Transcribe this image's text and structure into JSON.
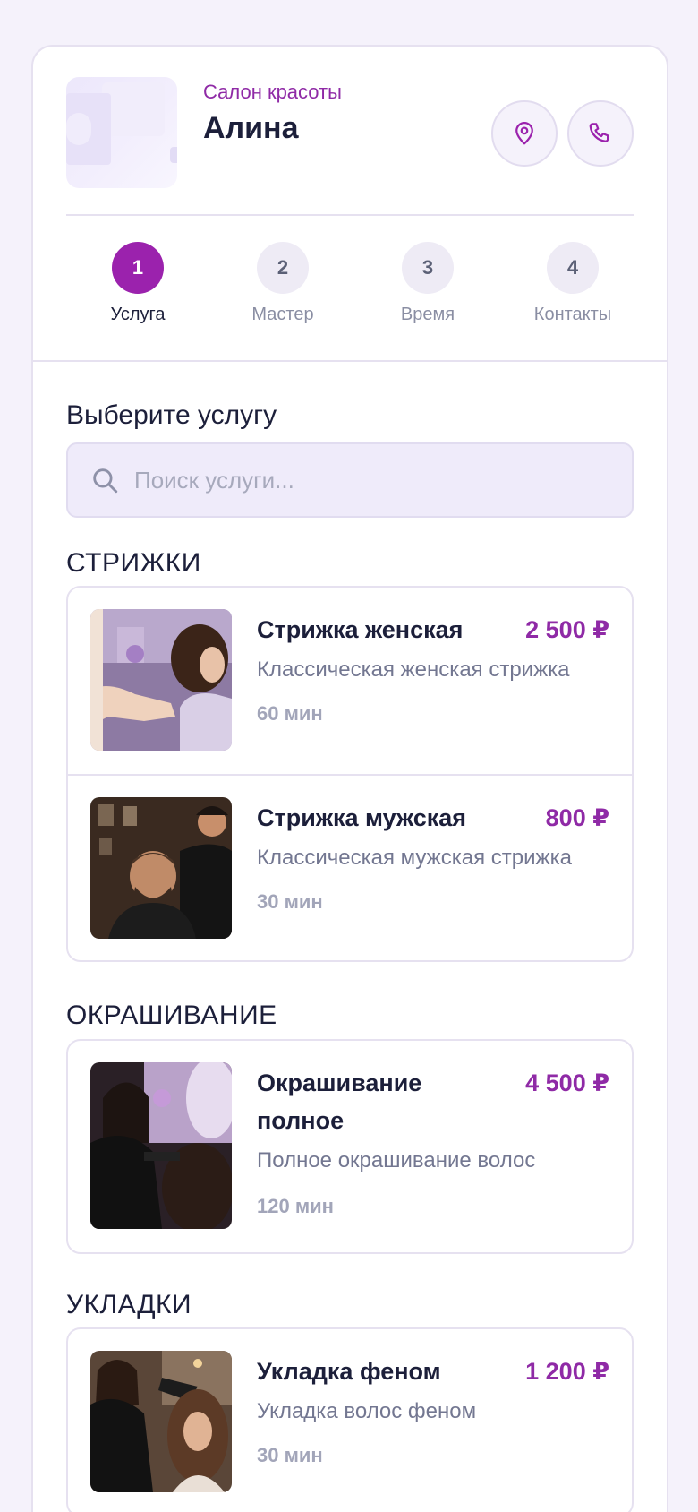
{
  "salon": {
    "subtitle": "Салон красоты",
    "name": "Алина",
    "location_icon": "map-pin-icon",
    "phone_icon": "phone-icon"
  },
  "steps": [
    {
      "num": "1",
      "label": "Услуга",
      "active": true
    },
    {
      "num": "2",
      "label": "Мастер",
      "active": false
    },
    {
      "num": "3",
      "label": "Время",
      "active": false
    },
    {
      "num": "4",
      "label": "Контакты",
      "active": false
    }
  ],
  "main": {
    "heading": "Выберите услугу",
    "search_placeholder": "Поиск услуги..."
  },
  "categories": [
    {
      "title": "СТРИЖКИ",
      "services": [
        {
          "name": "Стрижка женская",
          "price": "2 500 ₽",
          "desc": "Классическая женская стрижка",
          "duration": "60 мин"
        },
        {
          "name": "Стрижка мужская",
          "price": "800 ₽",
          "desc": "Классическая мужская стрижка",
          "duration": "30 мин"
        }
      ]
    },
    {
      "title": "ОКРАШИВАНИЕ",
      "services": [
        {
          "name": "Окрашивание полное",
          "price": "4 500 ₽",
          "desc": "Полное окрашивание волос",
          "duration": "120 мин"
        }
      ]
    },
    {
      "title": "УКЛАДКИ",
      "services": [
        {
          "name": "Укладка феном",
          "price": "1 200 ₽",
          "desc": "Укладка волос феном",
          "duration": "30 мин"
        }
      ]
    }
  ],
  "colors": {
    "accent": "#9b22ad",
    "price": "#8f2aa6",
    "background": "#f5f2fb"
  }
}
